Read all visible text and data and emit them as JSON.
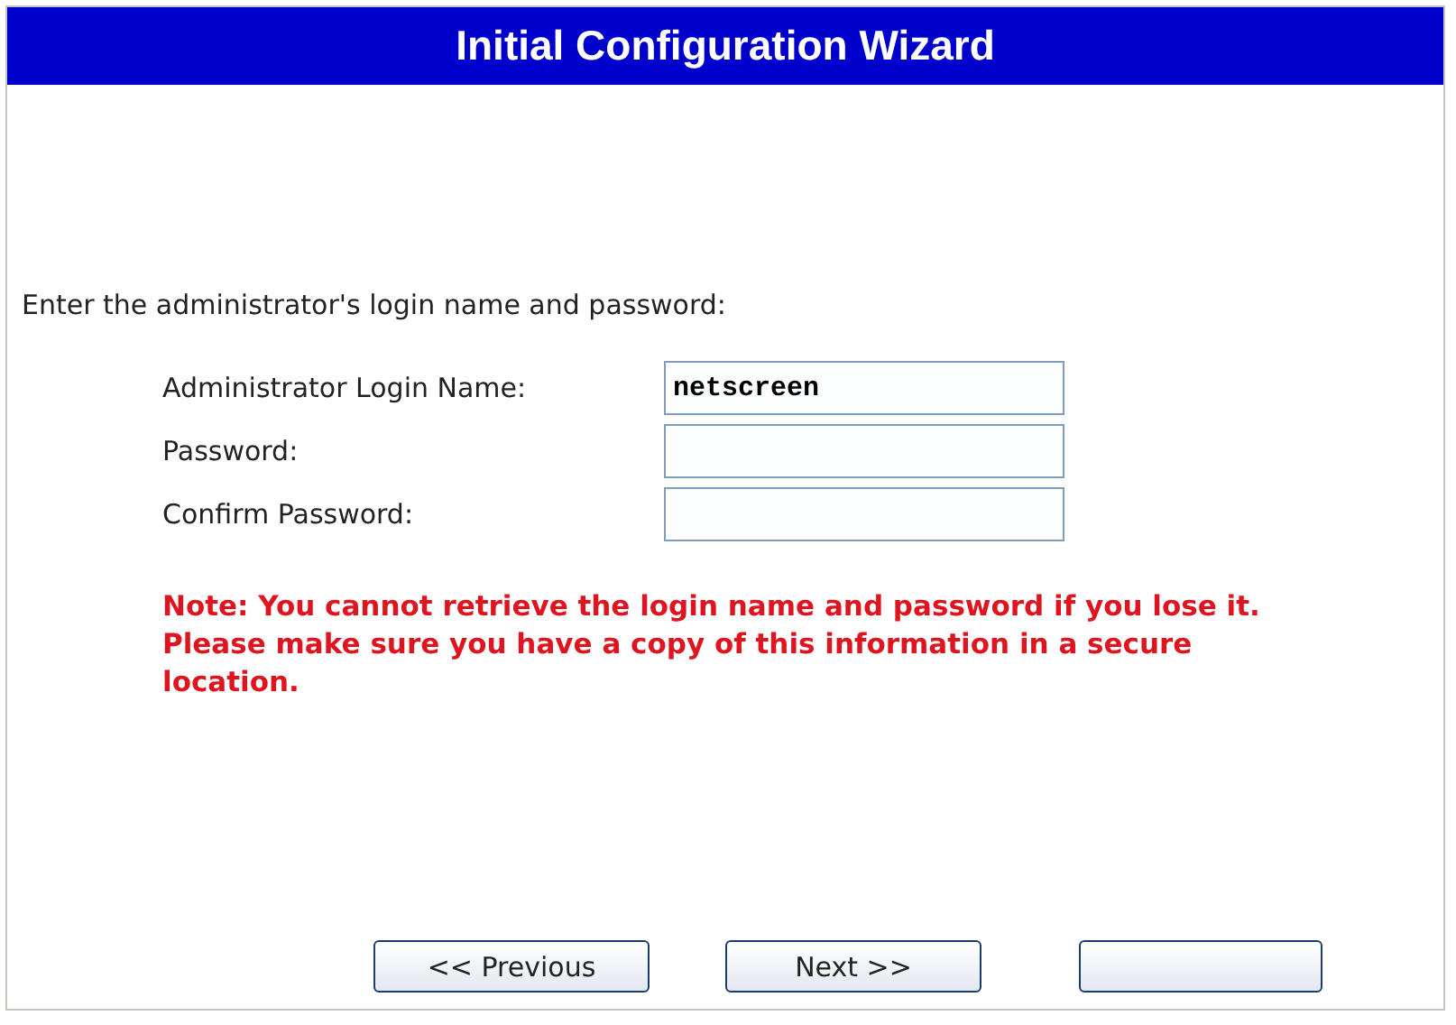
{
  "window": {
    "title": "Initial Configuration Wizard"
  },
  "instruction": "Enter the administrator's login name and password:",
  "fields": [
    {
      "label": "Administrator Login Name:",
      "value": "netscreen"
    },
    {
      "label": "Password:"
    },
    {
      "label": "Confirm Password:"
    }
  ],
  "note": "Note: You cannot retrieve the login name and password if you lose it. Please make sure you have a copy of this information in a secure location.",
  "buttons": [
    {
      "kind": "button",
      "label": "<< Previous"
    },
    {
      "kind": "button",
      "label": "Next >>"
    },
    {
      "kind": "button"
    }
  ]
}
